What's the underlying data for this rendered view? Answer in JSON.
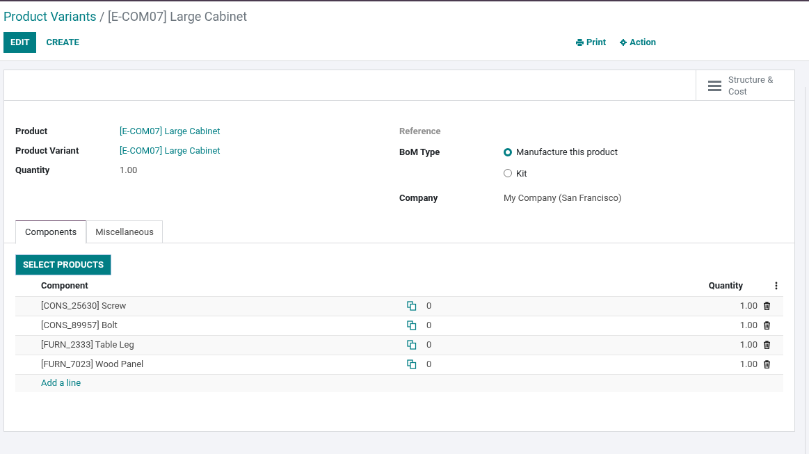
{
  "breadcrumb": {
    "parent": "Product Variants",
    "separator": "/",
    "current": "[E-COM07] Large Cabinet"
  },
  "actions": {
    "edit": "EDIT",
    "create": "CREATE",
    "print": "Print",
    "action": "Action"
  },
  "smart_button": {
    "label": "Structure & Cost"
  },
  "fields_left": [
    {
      "label": "Product",
      "value": "[E-COM07] Large Cabinet",
      "kind": "link"
    },
    {
      "label": "Product Variant",
      "value": "[E-COM07] Large Cabinet",
      "kind": "link"
    },
    {
      "label": "Quantity",
      "value": "1.00",
      "kind": "text"
    }
  ],
  "reference": {
    "label": "Reference"
  },
  "bom_type": {
    "label": "BoM Type",
    "options": [
      {
        "label": "Manufacture this product",
        "selected": true
      },
      {
        "label": "Kit",
        "selected": false
      }
    ]
  },
  "company": {
    "label": "Company",
    "value": "My Company (San Francisco)"
  },
  "tabs": [
    {
      "label": "Components",
      "selected": true
    },
    {
      "label": "Miscellaneous",
      "selected": false
    }
  ],
  "select_products": "SELECT PRODUCTS",
  "table": {
    "columns": [
      "Component",
      "Quantity"
    ],
    "rows": [
      {
        "component": "[CONS_25630] Screw",
        "count": "0",
        "quantity": "1.00"
      },
      {
        "component": "[CONS_89957] Bolt",
        "count": "0",
        "quantity": "1.00"
      },
      {
        "component": "[FURN_2333] Table Leg",
        "count": "0",
        "quantity": "1.00"
      },
      {
        "component": "[FURN_7023] Wood Panel",
        "count": "0",
        "quantity": "1.00"
      }
    ],
    "add_line": "Add a line"
  }
}
